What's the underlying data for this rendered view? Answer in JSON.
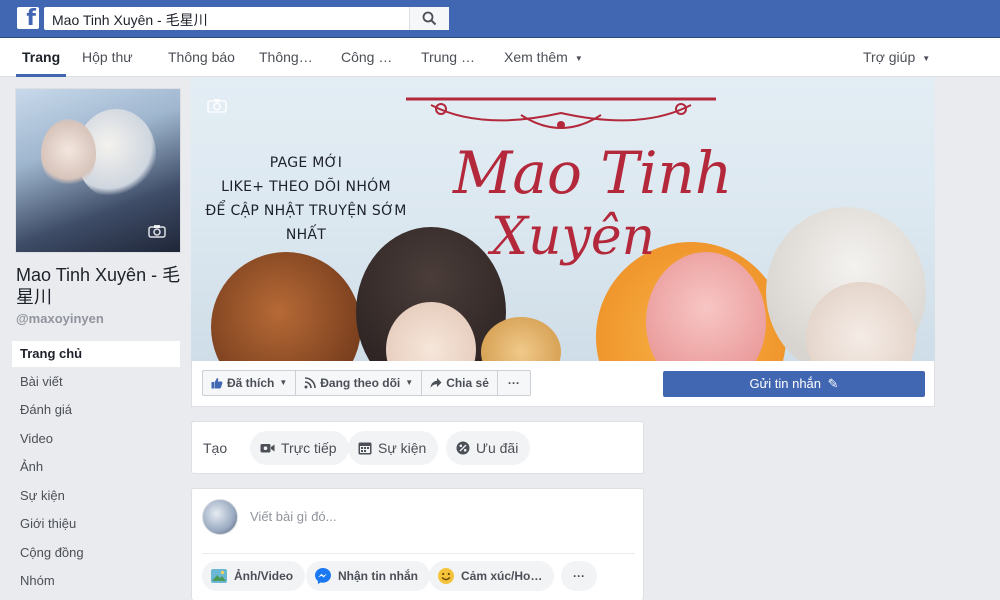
{
  "search": {
    "value": "Mao Tinh Xuyên - 毛星川"
  },
  "nav": {
    "items": [
      {
        "label": "Trang"
      },
      {
        "label": "Hộp thư"
      },
      {
        "label": "Thông báo"
      },
      {
        "label": "Thông…"
      },
      {
        "label": "Công …"
      },
      {
        "label": "Trung …"
      },
      {
        "label": "Xem thêm"
      },
      {
        "label": "Trợ giúp"
      }
    ]
  },
  "page": {
    "name": "Mao Tinh Xuyên - 毛星川",
    "handle": "@maxoyinyen"
  },
  "sidebar": {
    "items": [
      {
        "label": "Trang chủ"
      },
      {
        "label": "Bài viết"
      },
      {
        "label": "Đánh giá"
      },
      {
        "label": "Video"
      },
      {
        "label": "Ảnh"
      },
      {
        "label": "Sự kiện"
      },
      {
        "label": "Giới thiệu"
      },
      {
        "label": "Cộng đồng"
      },
      {
        "label": "Nhóm"
      }
    ]
  },
  "cover": {
    "promo_lines": [
      "PAGE MỚI",
      "LIKE+ THEO DÕI NHÓM",
      "ĐỂ CẬP NHẬT TRUYỆN SỚM NHẤT"
    ],
    "title_line1": "Mao Tinh",
    "title_line2": "Xuyên"
  },
  "actions": {
    "liked": "Đã thích",
    "following": "Đang theo dõi",
    "share": "Chia sẻ",
    "more": "···",
    "send_message": "Gửi tin nhắn"
  },
  "create": {
    "label": "Tạo",
    "live": "Trực tiếp",
    "event": "Sự kiện",
    "offer": "Ưu đãi"
  },
  "composer": {
    "placeholder": "Viết bài gì đó...",
    "photo_video": "Ảnh/Video",
    "message": "Nhận tin nhắn",
    "feeling": "Cảm xúc/Ho…",
    "more": "···"
  },
  "colors": {
    "brand": "#4267b2",
    "title": "#b3283b"
  }
}
